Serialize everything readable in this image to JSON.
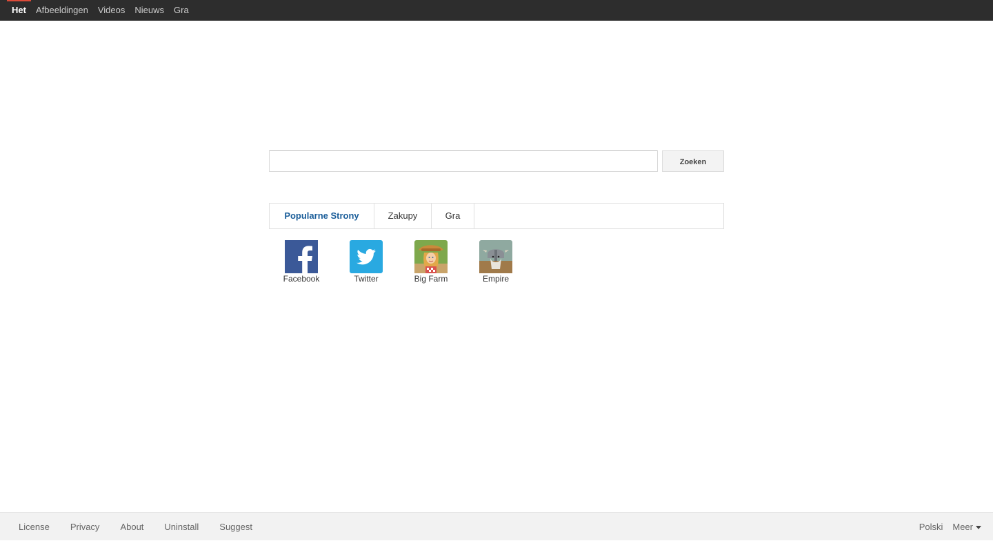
{
  "topnav": {
    "items": [
      {
        "label": "Het",
        "active": true
      },
      {
        "label": "Afbeeldingen"
      },
      {
        "label": "Videos"
      },
      {
        "label": "Nieuws"
      },
      {
        "label": "Gra"
      }
    ]
  },
  "search": {
    "value": "",
    "button_label": "Zoeken"
  },
  "tabs": [
    {
      "label": "Popularne Strony",
      "active": true
    },
    {
      "label": "Zakupy"
    },
    {
      "label": "Gra"
    }
  ],
  "tiles": [
    {
      "label": "Facebook",
      "icon": "facebook-icon"
    },
    {
      "label": "Twitter",
      "icon": "twitter-icon"
    },
    {
      "label": "Big Farm",
      "icon": "big-farm-icon"
    },
    {
      "label": "Empire",
      "icon": "empire-icon"
    }
  ],
  "footer": {
    "links": [
      "License",
      "Privacy",
      "About",
      "Uninstall",
      "Suggest"
    ],
    "language": "Polski",
    "more_label": "Meer"
  },
  "colors": {
    "topbar_bg": "#2d2d2d",
    "active_indicator": "#dd4b39",
    "active_tab_text": "#1a5d99",
    "facebook_blue": "#3b5998",
    "twitter_blue": "#29a9e1"
  }
}
